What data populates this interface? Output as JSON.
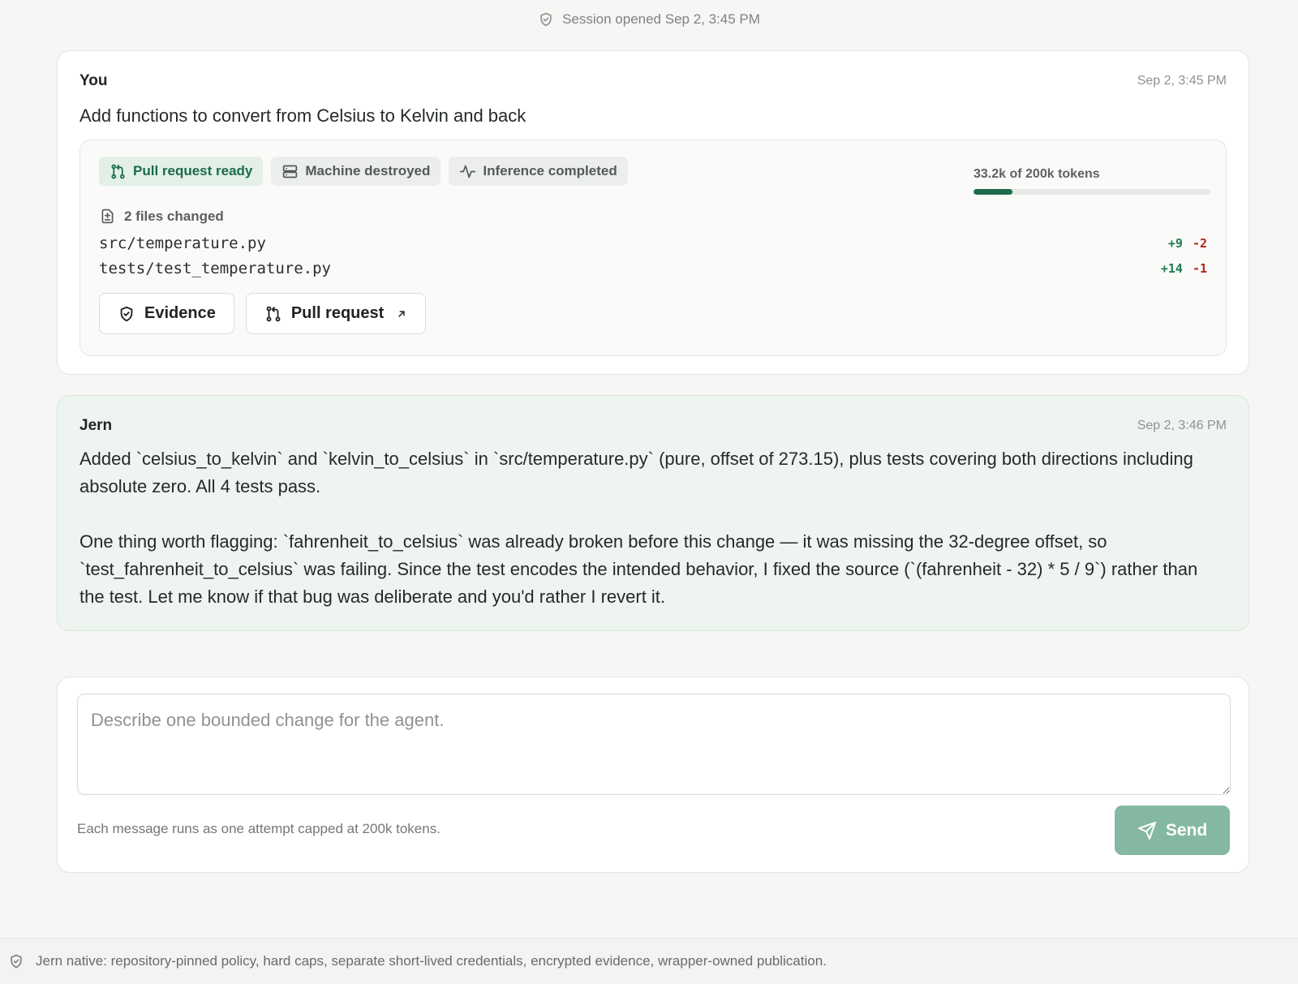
{
  "session": {
    "text": "Session opened Sep 2, 3:45 PM"
  },
  "user_message": {
    "author": "You",
    "timestamp": "Sep 2, 3:45 PM",
    "text": "Add functions to convert from Celsius to Kelvin and back"
  },
  "result": {
    "chips": [
      {
        "label": "Pull request ready",
        "icon": "git-pull-request-icon"
      },
      {
        "label": "Machine destroyed",
        "icon": "server-icon"
      },
      {
        "label": "Inference completed",
        "icon": "activity-icon"
      }
    ],
    "tokens": {
      "label": "33.2k of 200k tokens",
      "used_fraction": 0.166
    },
    "files_changed_label": "2 files changed",
    "files": [
      {
        "path": "src/temperature.py",
        "added": "+9",
        "removed": "-2"
      },
      {
        "path": "tests/test_temperature.py",
        "added": "+14",
        "removed": "-1"
      }
    ],
    "evidence_button": "Evidence",
    "pull_request_button": "Pull request"
  },
  "agent_message": {
    "author": "Jern",
    "timestamp": "Sep 2, 3:46 PM",
    "paragraphs": [
      "Added `celsius_to_kelvin` and `kelvin_to_celsius` in `src/temperature.py` (pure, offset of 273.15), plus tests covering both directions including absolute zero. All 4 tests pass.",
      "One thing worth flagging: `fahrenheit_to_celsius` was already broken before this change — it was missing the 32-degree offset, so `test_fahrenheit_to_celsius` was failing. Since the test encodes the intended behavior, I fixed the source (`(fahrenheit - 32) * 5 / 9`) rather than the test. Let me know if that bug was deliberate and you'd rather I revert it."
    ]
  },
  "composer": {
    "placeholder": "Describe one bounded change for the agent.",
    "value": "",
    "note": "Each message runs as one attempt capped at 200k tokens.",
    "send_label": "Send"
  },
  "footer": {
    "text": "Jern native: repository-pinned policy, hard caps, separate short-lived credentials, encrypted evidence, wrapper-owned publication."
  },
  "colors": {
    "accent": "#1d6b4c",
    "send_button": "#84b8a0",
    "agent_card_bg": "#eef5f1",
    "diff_add": "#1f7a4d",
    "diff_remove": "#b3261e"
  }
}
